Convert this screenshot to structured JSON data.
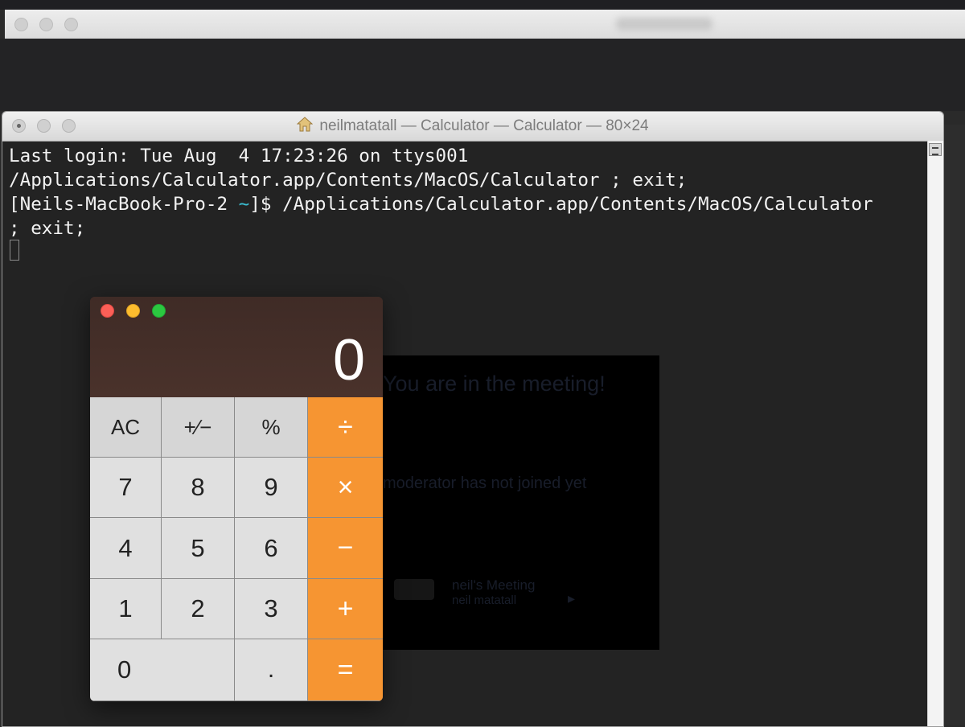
{
  "background_window": {},
  "terminal": {
    "title": "neilmatatall — Calculator — Calculator — 80×24",
    "line1": "Last login: Tue Aug  4 17:23:26 on ttys001",
    "line2": "/Applications/Calculator.app/Contents/MacOS/Calculator ; exit;",
    "line3_prefix": "[Neils-MacBook-Pro-2 ",
    "line3_tilde": "~",
    "line3_suffix": "]$ /Applications/Calculator.app/Contents/MacOS/Calculator",
    "line4": "; exit;"
  },
  "meeting": {
    "title": "You are in the meeting!",
    "subtitle": "moderator has not joined yet",
    "meeting_name": "neil's Meeting",
    "user_name": "neil matatall"
  },
  "calculator": {
    "display": "0",
    "keys": {
      "ac": "AC",
      "sign": "+∕−",
      "percent": "%",
      "divide": "÷",
      "seven": "7",
      "eight": "8",
      "nine": "9",
      "multiply": "×",
      "four": "4",
      "five": "5",
      "six": "6",
      "minus": "−",
      "one": "1",
      "two": "2",
      "three": "3",
      "plus": "+",
      "zero": "0",
      "decimal": ".",
      "equals": "="
    }
  },
  "colors": {
    "operator_key": "#f69532",
    "function_key": "#d6d6d6",
    "number_key": "#e0e0e0",
    "calc_display_bg": "#3f2b26",
    "terminal_bg": "#232323",
    "tilde_cyan": "#3bbfd3"
  },
  "icons": [
    "home-icon",
    "scroll-icon"
  ]
}
